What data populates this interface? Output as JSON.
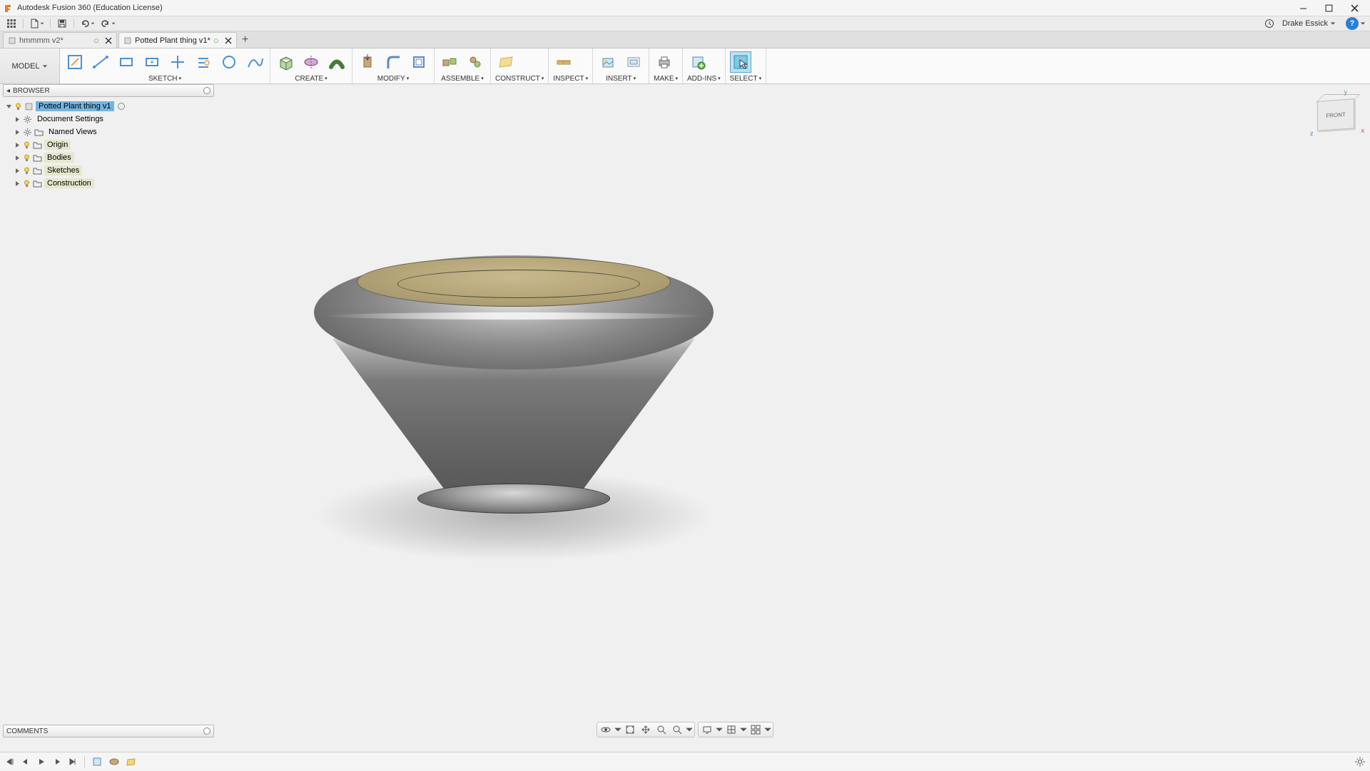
{
  "app": {
    "title": "Autodesk Fusion 360 (Education License)",
    "user_name": "Drake Essick"
  },
  "tabs": [
    {
      "name": "hmmmm v2*",
      "active": false,
      "dirty": true
    },
    {
      "name": "Potted Plant thing v1*",
      "active": true,
      "dirty": true
    }
  ],
  "workspace": {
    "label": "MODEL"
  },
  "ribbon_groups": [
    {
      "label": "SKETCH"
    },
    {
      "label": "CREATE"
    },
    {
      "label": "MODIFY"
    },
    {
      "label": "ASSEMBLE"
    },
    {
      "label": "CONSTRUCT"
    },
    {
      "label": "INSPECT"
    },
    {
      "label": "INSERT"
    },
    {
      "label": "MAKE"
    },
    {
      "label": "ADD-INS"
    },
    {
      "label": "SELECT"
    }
  ],
  "browser": {
    "title": "BROWSER",
    "root": "Potted Plant thing v1",
    "items": [
      {
        "label": "Document Settings",
        "bulb": false,
        "icon": "gear",
        "hl": false
      },
      {
        "label": "Named Views",
        "bulb": false,
        "icon": "folder",
        "hl": false
      },
      {
        "label": "Origin",
        "bulb": true,
        "icon": "folder",
        "hl": true
      },
      {
        "label": "Bodies",
        "bulb": true,
        "icon": "folder",
        "hl": true
      },
      {
        "label": "Sketches",
        "bulb": true,
        "icon": "folder",
        "hl": true
      },
      {
        "label": "Construction",
        "bulb": true,
        "icon": "folder",
        "hl": true
      }
    ]
  },
  "viewcube": {
    "face": "FRONT",
    "axes": {
      "x": "x",
      "y": "y",
      "z": "z"
    }
  },
  "comments": {
    "title": "COMMENTS"
  }
}
